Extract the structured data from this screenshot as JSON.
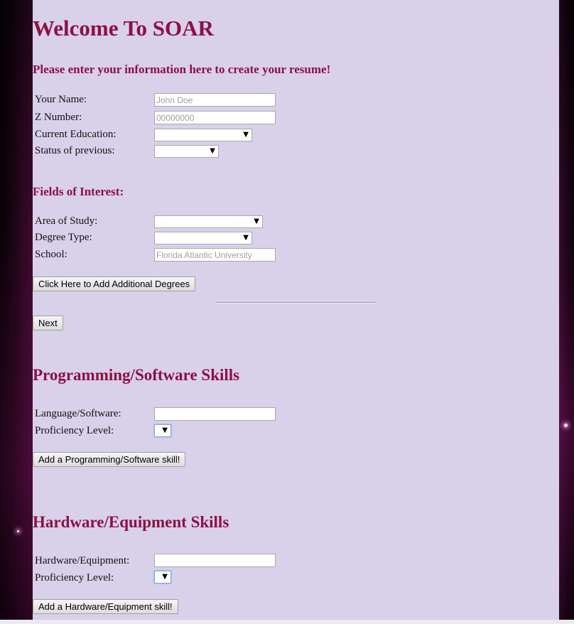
{
  "page": {
    "title": "Welcome To SOAR",
    "subtitle": "Please enter your information here to create your resume!"
  },
  "personal": {
    "name_label": "Your Name:",
    "name_placeholder": "John Doe",
    "znumber_label": "Z Number:",
    "znumber_placeholder": "00000000",
    "education_label": "Current Education:",
    "education_value": "",
    "status_label": "Status of previous:",
    "status_value": ""
  },
  "interest": {
    "heading": "Fields of Interest:",
    "area_label": "Area of Study:",
    "area_value": "",
    "degree_label": "Degree Type:",
    "degree_value": "",
    "school_label": "School:",
    "school_placeholder": "Florida Atlantic University",
    "add_degrees_button": "Click Here to Add Additional Degrees",
    "next_button": "Next"
  },
  "programming": {
    "heading": "Programming/Software Skills",
    "language_label": "Language/Software:",
    "language_value": "",
    "proficiency_label": "Proficiency Level:",
    "proficiency_value": "",
    "add_button": "Add a Programming/Software skill!"
  },
  "hardware": {
    "heading": "Hardware/Equipment Skills",
    "equipment_label": "Hardware/Equipment:",
    "equipment_value": "",
    "proficiency_label": "Proficiency Level:",
    "proficiency_value": "",
    "add_button": "Add a Hardware/Equipment skill!"
  },
  "icons": {
    "dropdown": "chevron-down-icon"
  },
  "colors": {
    "heading": "#8c1046",
    "panel": "#d9d0e9",
    "focus_border": "#7ea6e0"
  }
}
